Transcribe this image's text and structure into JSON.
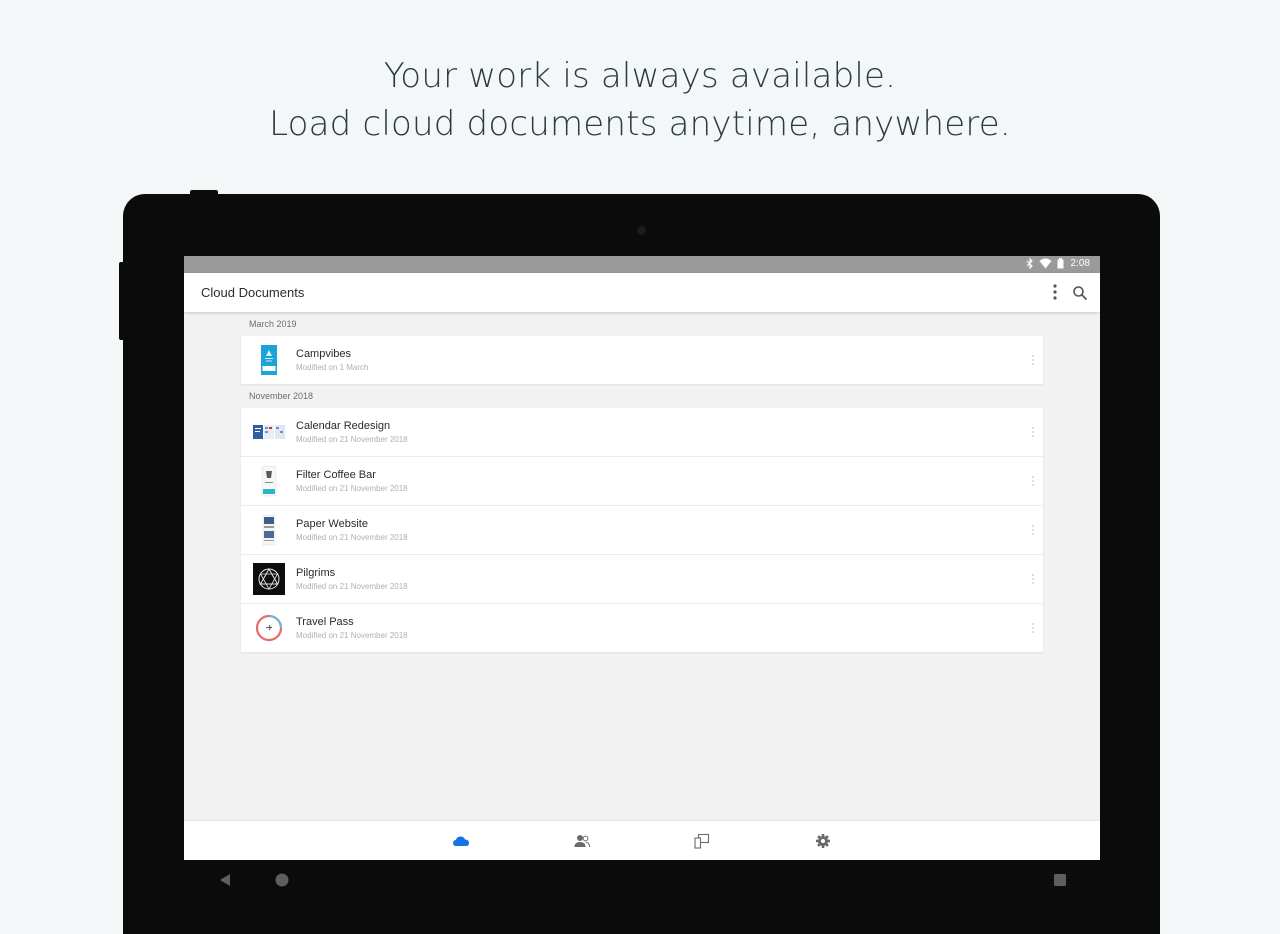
{
  "headline": {
    "line1": "Your work is always available.",
    "line2": "Load cloud documents anytime, anywhere."
  },
  "statusbar": {
    "time": "2:08",
    "icons": [
      "bluetooth-icon",
      "wifi-icon",
      "battery-icon"
    ]
  },
  "appbar": {
    "title": "Cloud Documents",
    "icons": [
      "more-vertical-icon",
      "search-icon"
    ]
  },
  "sections": [
    {
      "header": "March 2019",
      "items": [
        {
          "name": "Campvibes",
          "modified": "Modified on 1 March",
          "thumb": "campvibes"
        }
      ]
    },
    {
      "header": "November 2018",
      "items": [
        {
          "name": "Calendar Redesign",
          "modified": "Modified on 21 November 2018",
          "thumb": "calendar"
        },
        {
          "name": "Filter Coffee Bar",
          "modified": "Modified on 21 November 2018",
          "thumb": "coffee"
        },
        {
          "name": "Paper Website",
          "modified": "Modified on 21 November 2018",
          "thumb": "paper"
        },
        {
          "name": "Pilgrims",
          "modified": "Modified on 21 November 2018",
          "thumb": "pilgrims"
        },
        {
          "name": "Travel Pass",
          "modified": "Modified on 21 November 2018",
          "thumb": "travel"
        }
      ]
    }
  ],
  "bottom_nav": [
    {
      "icon": "cloud-icon",
      "active": true
    },
    {
      "icon": "people-icon",
      "active": false
    },
    {
      "icon": "devices-icon",
      "active": false
    },
    {
      "icon": "gear-icon",
      "active": false
    }
  ],
  "colors": {
    "background": "#f4f7f8",
    "headline": "#2b3a44",
    "accent_blue": "#1473e6",
    "statusbar": "#9a9a9a",
    "bezel": "#0b0b0b"
  }
}
